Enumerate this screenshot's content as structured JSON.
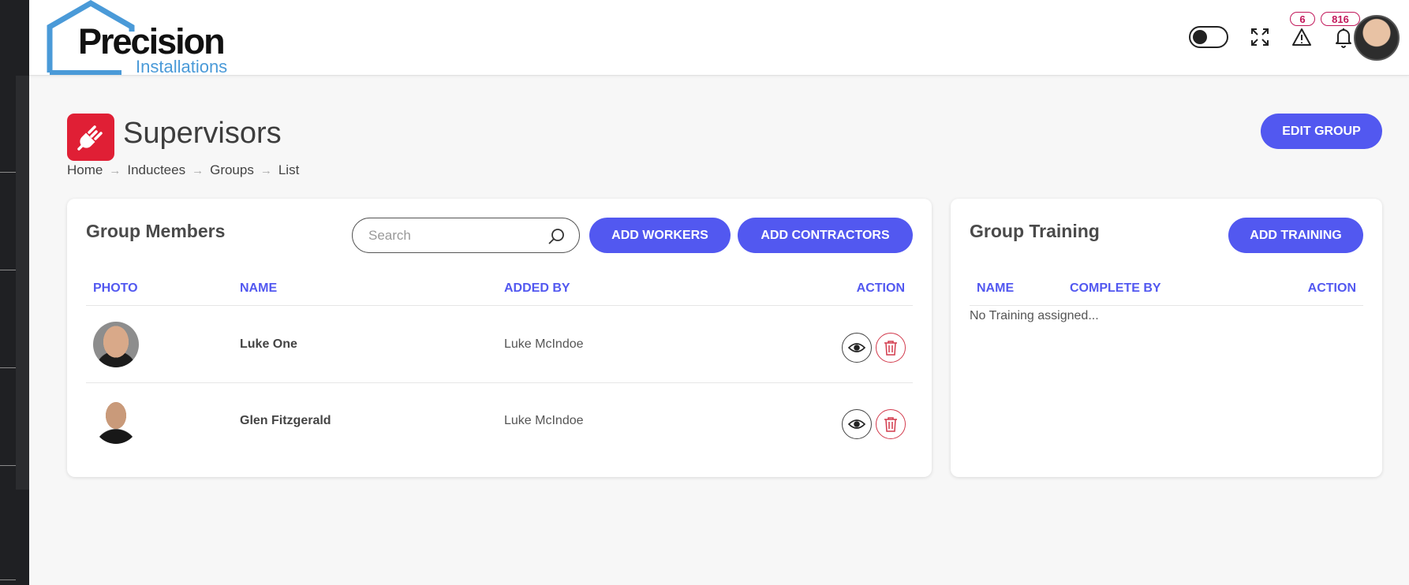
{
  "brand": {
    "logo_word": "Precision",
    "logo_sub": "Installations"
  },
  "header": {
    "alerts_count": "6",
    "notifications_count": "816"
  },
  "page": {
    "title": "Supervisors",
    "breadcrumb": [
      "Home",
      "Inductees",
      "Groups",
      "List"
    ],
    "edit_button": "EDIT GROUP"
  },
  "members": {
    "title": "Group Members",
    "search_placeholder": "Search",
    "add_workers": "ADD WORKERS",
    "add_contractors": "ADD CONTRACTORS",
    "columns": [
      "PHOTO",
      "NAME",
      "ADDED BY",
      "ACTION"
    ],
    "rows": [
      {
        "name": "Luke One",
        "added_by": "Luke McIndoe"
      },
      {
        "name": "Glen Fitzgerald",
        "added_by": "Luke McIndoe"
      }
    ]
  },
  "training": {
    "title": "Group Training",
    "add_training": "ADD TRAINING",
    "columns": [
      "NAME",
      "COMPLETE BY",
      "ACTION"
    ],
    "empty_text": "No Training assigned..."
  },
  "colors": {
    "accent": "#5258f0",
    "danger": "#e01f35",
    "badge": "#c2185b"
  },
  "icons": {
    "title": "plug-icon",
    "toggle": "theme-toggle",
    "fullscreen": "expand-icon",
    "alerts": "warning-icon",
    "notifications": "bell-icon",
    "view": "eye-icon",
    "delete": "trash-icon",
    "search": "search-icon"
  }
}
